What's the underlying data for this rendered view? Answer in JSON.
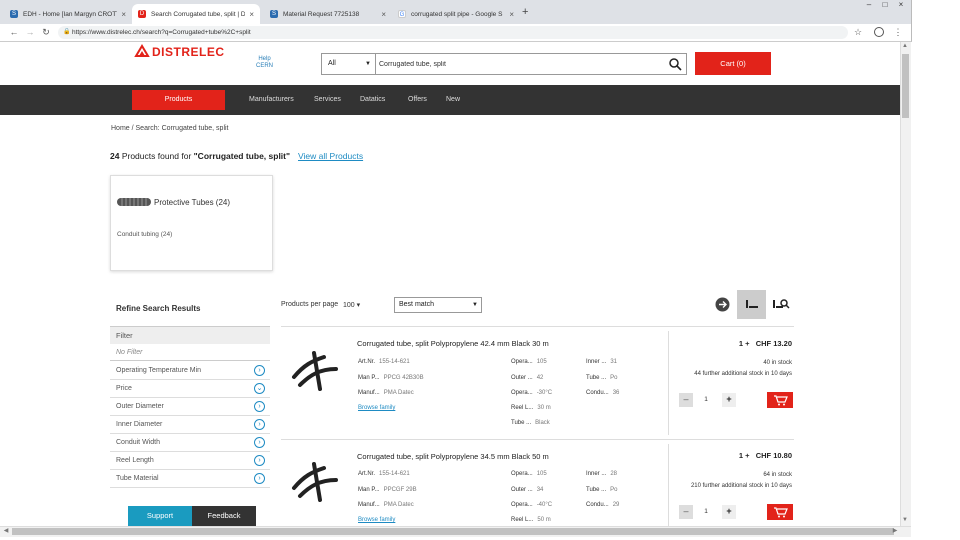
{
  "browser": {
    "tabs": [
      {
        "title": "EDH - Home [Ian Margyn CROTT/",
        "active": false
      },
      {
        "title": "Search Corrugated tube, split | D",
        "active": true
      },
      {
        "title": "Material Request 7725138",
        "active": false
      },
      {
        "title": "corrugated split pipe - Google S",
        "active": false
      }
    ],
    "new_tab": "+",
    "url": "https://www.distrelec.ch/search?q=Corrugated+tube%2C+split"
  },
  "header": {
    "logo_text": "DISTRELEC",
    "cern_label": "Help\nCERN",
    "search_category": "All",
    "search_value": "Corrugated tube, split",
    "cart_label": "Cart (0)"
  },
  "nav": {
    "products": "Products",
    "items": [
      "Manufacturers",
      "Services",
      "Datatics",
      "Offers",
      "New"
    ]
  },
  "breadcrumb": "Home /  Search: Corrugated tube, split",
  "results": {
    "count": "24",
    "text_mid": " Products found for ",
    "query": "\"Corrugated tube, split\"",
    "view_all": "View all Products"
  },
  "category_card": {
    "name": "Protective Tubes (24)",
    "sub": "Conduit tubing (24)"
  },
  "sidebar": {
    "title": "Refine Search Results",
    "filter_head": "Filter",
    "no_filter": "No Filter",
    "facets": [
      "Operating Temperature Min",
      "Price",
      "Outer Diameter",
      "Inner Diameter",
      "Conduit Width",
      "Reel Length",
      "Tube Material"
    ],
    "support": "Support",
    "feedback": "Feedback"
  },
  "list_controls": {
    "per_page_label": "Products per page",
    "per_page_value": "100",
    "sort_value": "Best match"
  },
  "products": [
    {
      "title": "Corrugated tube, split Polypropylene 42.4 mm Black 30 m",
      "specs_col1": [
        {
          "k": "Art.Nr.",
          "v": "155-14-621"
        },
        {
          "k": "Man P...",
          "v": "PPCG 42B30B"
        },
        {
          "k": "Manuf...",
          "v": "PMA Datec"
        }
      ],
      "specs_col2": [
        {
          "k": "Opera...",
          "v": "105"
        },
        {
          "k": "Outer ...",
          "v": "42"
        },
        {
          "k": "Opera...",
          "v": "-30°C"
        },
        {
          "k": "Reel L...",
          "v": "30 m"
        },
        {
          "k": "Tube ...",
          "v": "Black"
        }
      ],
      "specs_col3": [
        {
          "k": "Inner ...",
          "v": "31"
        },
        {
          "k": "Tube ...",
          "v": "Po"
        },
        {
          "k": "Condu...",
          "v": "36"
        }
      ],
      "browse": "Browse family",
      "qty_break": "1 +",
      "price": "CHF  13.20",
      "stock1": "40 in stock",
      "stock2": "44 further additional stock in 10 days",
      "qty": "1"
    },
    {
      "title": "Corrugated tube, split Polypropylene 34.5 mm Black 50 m",
      "specs_col1": [
        {
          "k": "Art.Nr.",
          "v": "155-14-621"
        },
        {
          "k": "Man P...",
          "v": "PPCGF 29B"
        },
        {
          "k": "Manuf...",
          "v": "PMA Datec"
        }
      ],
      "specs_col2": [
        {
          "k": "Opera...",
          "v": "105"
        },
        {
          "k": "Outer ...",
          "v": "34"
        },
        {
          "k": "Opera...",
          "v": "-40°C"
        },
        {
          "k": "Reel L...",
          "v": "50 m"
        }
      ],
      "specs_col3": [
        {
          "k": "Inner ...",
          "v": "28"
        },
        {
          "k": "Tube ...",
          "v": "Po"
        },
        {
          "k": "Condu...",
          "v": "29"
        }
      ],
      "browse": "Browse family",
      "qty_break": "1 +",
      "price": "CHF  10.80",
      "stock1": "64 in stock",
      "stock2": "210 further additional stock in 10 days",
      "qty": "1"
    }
  ],
  "colors": {
    "brand_red": "#e2231a",
    "link_blue": "#1e8bc3",
    "nav_dark": "#333333",
    "support_teal": "#1a9bc0"
  }
}
